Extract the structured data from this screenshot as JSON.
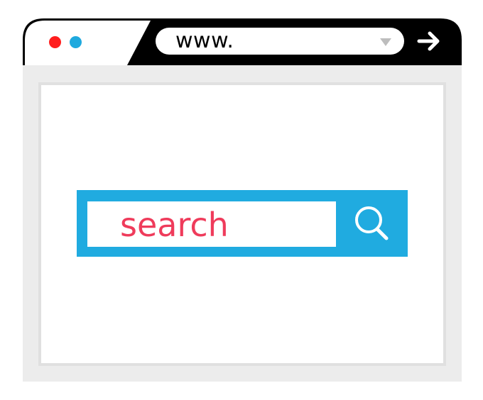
{
  "browser": {
    "window_dots": [
      {
        "name": "red",
        "color": "#ff1e1e"
      },
      {
        "name": "blue",
        "color": "#1fa9de"
      }
    ],
    "address_bar": {
      "value": "www.",
      "dropdown_icon": "triangle-down-icon"
    },
    "go_button_icon": "arrow-right-icon"
  },
  "page": {
    "search_box": {
      "value": "search",
      "button_icon": "magnifier-icon",
      "accent_color": "#20abe0",
      "text_color": "#ef3b5b"
    }
  }
}
